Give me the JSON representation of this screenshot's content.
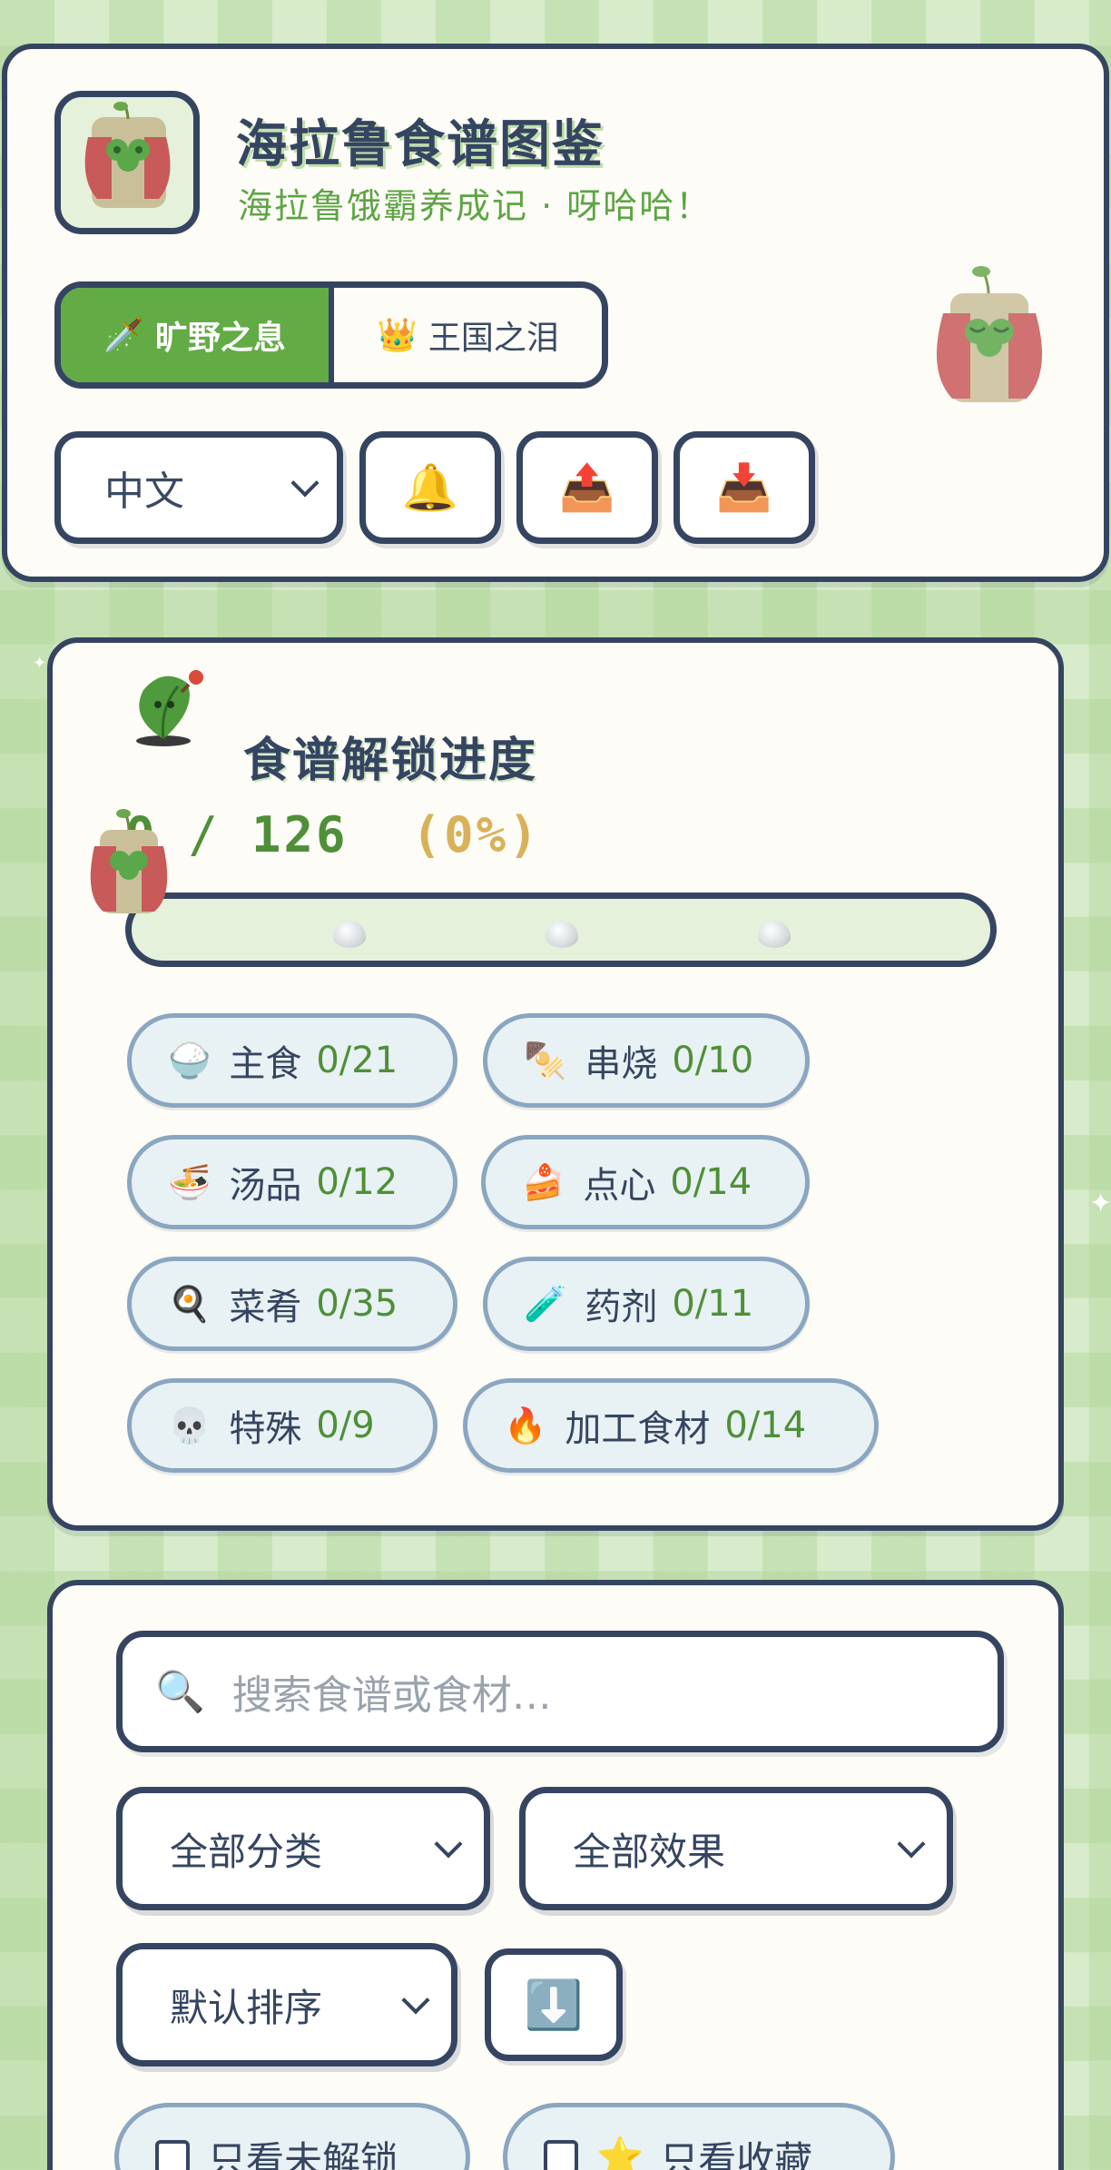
{
  "header": {
    "title": "海拉鲁食谱图鉴",
    "subtitle": "海拉鲁饿霸养成记 · 呀哈哈！",
    "game_toggle": [
      {
        "icon": "🗡️",
        "label": "旷野之息",
        "active": true
      },
      {
        "icon": "👑",
        "label": "王国之泪",
        "active": false
      }
    ],
    "language": "中文",
    "bell_icon": "🔔",
    "export_icon": "📤",
    "import_icon": "📥"
  },
  "progress": {
    "title": "食谱解锁进度",
    "unlocked": "0",
    "separator": "/",
    "total": "126",
    "percent": "(0%)",
    "fraction": 0,
    "categories": [
      {
        "icon": "🍚",
        "label": "主食",
        "count": "0/21"
      },
      {
        "icon": "🍢",
        "label": "串烧",
        "count": "0/10"
      },
      {
        "icon": "🍜",
        "label": "汤品",
        "count": "0/12"
      },
      {
        "icon": "🍰",
        "label": "点心",
        "count": "0/14"
      },
      {
        "icon": "🍳",
        "label": "菜肴",
        "count": "0/35"
      },
      {
        "icon": "🧪",
        "label": "药剂",
        "count": "0/11"
      },
      {
        "icon": "💀",
        "label": "特殊",
        "count": "0/9"
      },
      {
        "icon": "🔥",
        "label": "加工食材",
        "count": "0/14"
      }
    ]
  },
  "filters": {
    "search_icon": "🔍",
    "search_placeholder": "搜索食谱或食材…",
    "category_select": "全部分类",
    "effect_select": "全部效果",
    "sort_select": "默认排序",
    "sort_dir_icon": "⬇️",
    "only_locked": "只看未解锁",
    "only_favorites_icon": "⭐",
    "only_favorites": "只看收藏"
  },
  "colors": {
    "accent_green": "#62ab45",
    "ink": "#354561",
    "card_bg": "#fdfcf7",
    "gold": "#d9b15a"
  }
}
